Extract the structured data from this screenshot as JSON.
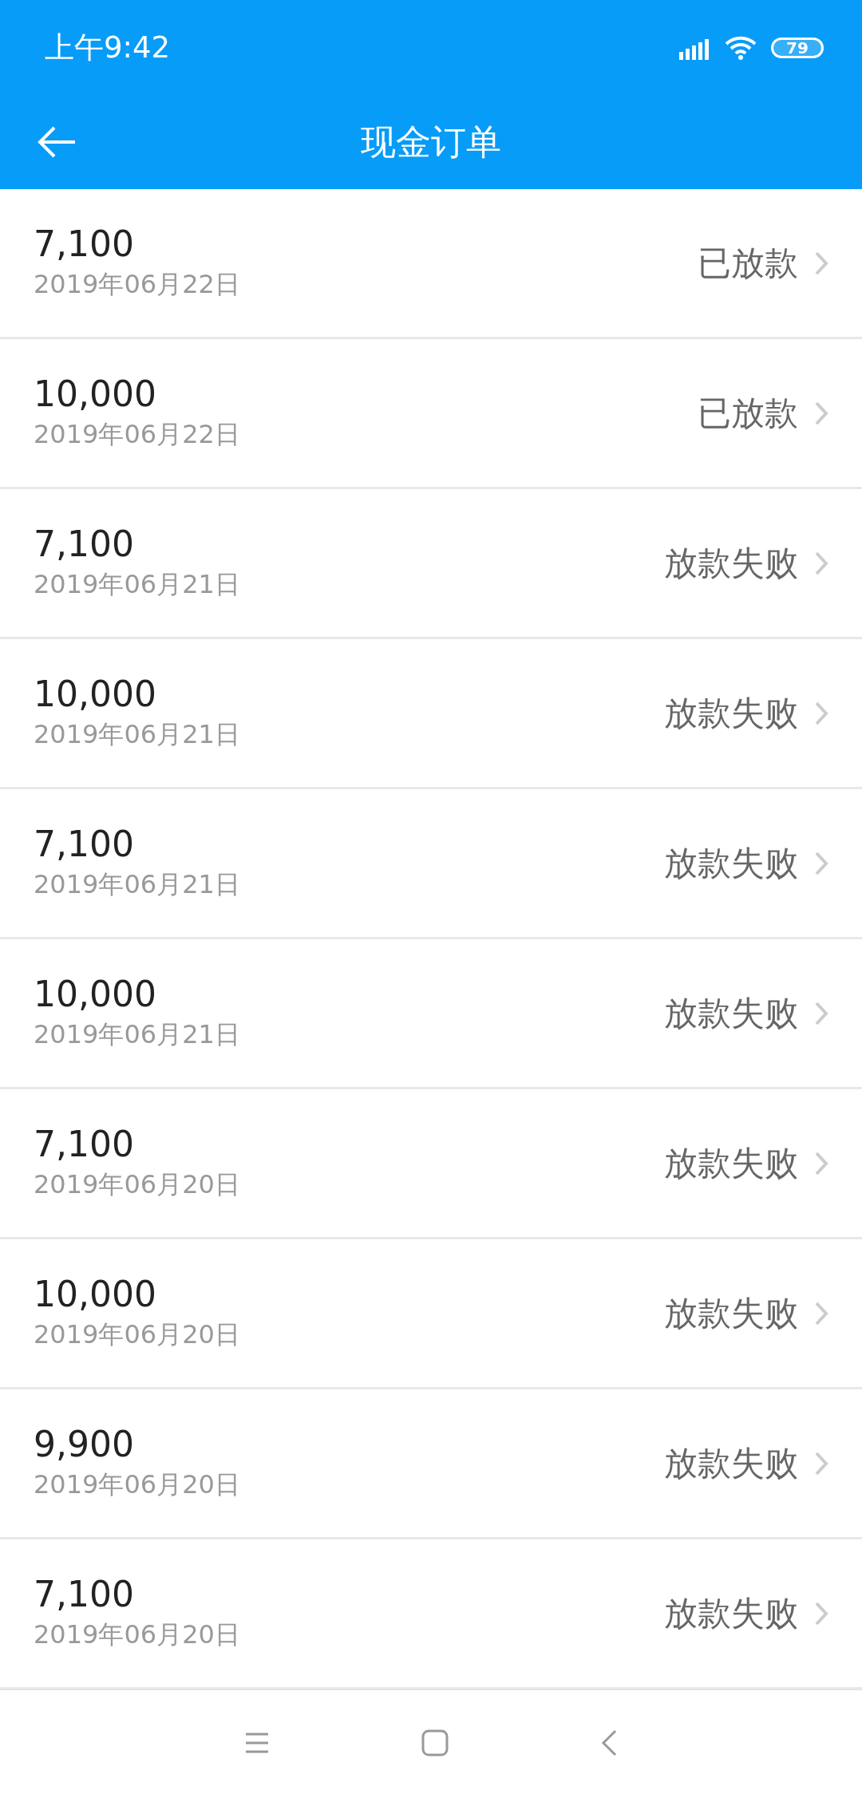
{
  "status_bar": {
    "time": "上午9:42",
    "battery": "79"
  },
  "header": {
    "title": "现金订单"
  },
  "orders": [
    {
      "amount": "7,100",
      "date": "2019年06月22日",
      "status": "已放款"
    },
    {
      "amount": "10,000",
      "date": "2019年06月22日",
      "status": "已放款"
    },
    {
      "amount": "7,100",
      "date": "2019年06月21日",
      "status": "放款失败"
    },
    {
      "amount": "10,000",
      "date": "2019年06月21日",
      "status": "放款失败"
    },
    {
      "amount": "7,100",
      "date": "2019年06月21日",
      "status": "放款失败"
    },
    {
      "amount": "10,000",
      "date": "2019年06月21日",
      "status": "放款失败"
    },
    {
      "amount": "7,100",
      "date": "2019年06月20日",
      "status": "放款失败"
    },
    {
      "amount": "10,000",
      "date": "2019年06月20日",
      "status": "放款失败"
    },
    {
      "amount": "9,900",
      "date": "2019年06月20日",
      "status": "放款失败"
    },
    {
      "amount": "7,100",
      "date": "2019年06月20日",
      "status": "放款失败"
    }
  ]
}
